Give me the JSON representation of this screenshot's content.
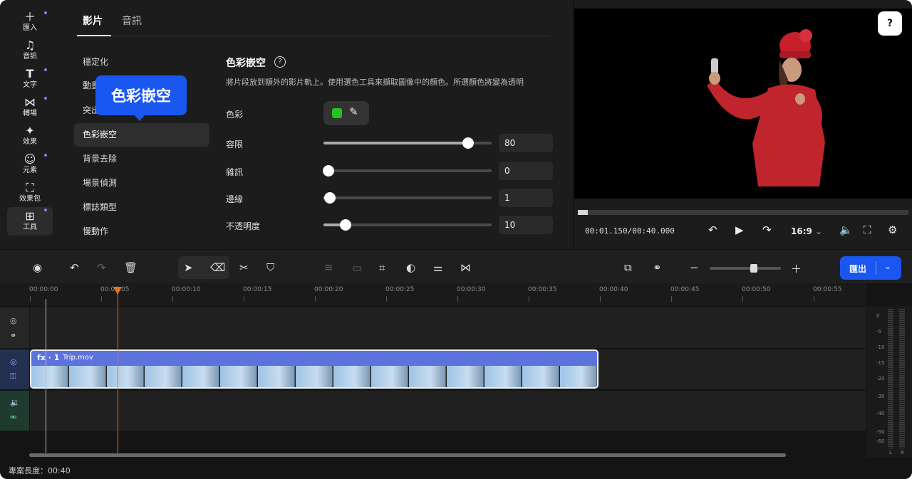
{
  "rail": {
    "items": [
      {
        "label": "匯入",
        "icon": "plus-icon"
      },
      {
        "label": "音訊",
        "icon": "music-note-icon"
      },
      {
        "label": "文字",
        "icon": "text-icon"
      },
      {
        "label": "轉場",
        "icon": "transition-icon"
      },
      {
        "label": "效果",
        "icon": "sparkle-icon"
      },
      {
        "label": "元素",
        "icon": "smiley-icon"
      },
      {
        "label": "效果包",
        "icon": "bag-icon"
      },
      {
        "label": "工具",
        "icon": "grid-icon"
      }
    ]
  },
  "panel": {
    "tabs": [
      "影片",
      "音訊"
    ],
    "menu": [
      "穩定化",
      "動畫",
      "突出",
      "色彩嵌空",
      "背景去除",
      "場景偵測",
      "標誌類型",
      "慢動作"
    ],
    "menu_partial": {
      "item1": "動畫",
      "item2": "突出"
    },
    "tooltip": "色彩嵌空",
    "section_title": "色彩嵌空",
    "section_desc": "將片段放到額外的影片軌上。使用選色工具來擷取圖像中的顏色。所選顏色將變為透明",
    "color_label": "色彩",
    "color_value": "#22c41e",
    "sliders": [
      {
        "label": "容限",
        "value": "80",
        "fraction": 0.86
      },
      {
        "label": "雜訊",
        "value": "0",
        "fraction": 0.03
      },
      {
        "label": "邊緣",
        "value": "1",
        "fraction": 0.04
      },
      {
        "label": "不透明度",
        "value": "10",
        "fraction": 0.13
      }
    ]
  },
  "preview": {
    "help": "?",
    "timecode": "00:01.150/00:40.000",
    "ratio": "16:9",
    "progress": 0.03
  },
  "toolbar": {
    "export_label": "匯出"
  },
  "timeline": {
    "ticks": [
      "00:00:00",
      "00:00:05",
      "00:00:10",
      "00:00:15",
      "00:00:20",
      "00:00:25",
      "00:00:30",
      "00:00:35",
      "00:00:40",
      "00:00:45",
      "00:00:50",
      "00:00:55"
    ],
    "clip_fx": "fx · 1",
    "clip_name": "Trip.mov",
    "meter_scale": [
      "0",
      "-5",
      "-10",
      "-15",
      "-20",
      "-30",
      "-40",
      "-50",
      "-60"
    ],
    "meter_lr": [
      "L",
      "R"
    ]
  },
  "footer": "專案長度：00:40"
}
